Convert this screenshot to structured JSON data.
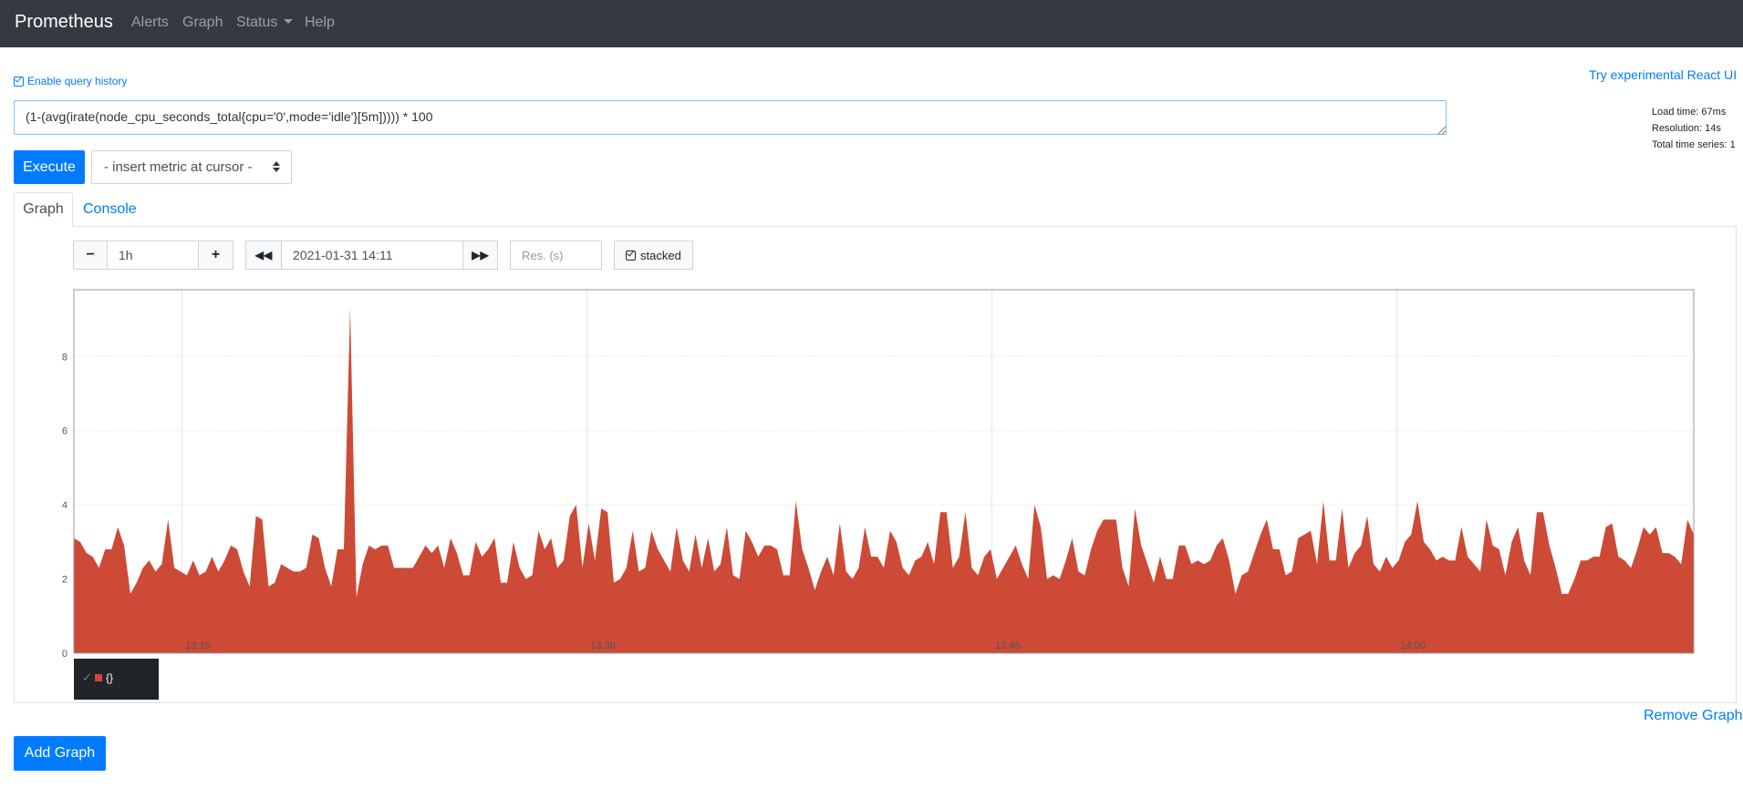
{
  "navbar": {
    "brand": "Prometheus",
    "items": [
      "Alerts",
      "Graph",
      "Status",
      "Help"
    ]
  },
  "history_label": "Enable query history",
  "react_link": "Try experimental React UI",
  "stats": {
    "load_time": "Load time: 67ms",
    "resolution": "Resolution: 14s",
    "total_series": "Total time series: 1"
  },
  "expression": "(1-(avg(irate(node_cpu_seconds_total{cpu='0',mode='idle'}[5m])))) * 100",
  "execute_label": "Execute",
  "metric_select": "- insert metric at cursor -",
  "tabs": {
    "graph": "Graph",
    "console": "Console"
  },
  "controls": {
    "range": "1h",
    "end_time": "2021-01-31 14:11",
    "res_placeholder": "Res. (s)",
    "stacked": "stacked"
  },
  "legend": {
    "label": "{}"
  },
  "remove_label": "Remove Graph",
  "add_label": "Add Graph",
  "colors": {
    "series": "#cc4a36",
    "primary": "#007bff",
    "navbar": "#343a40"
  },
  "icons": [
    "check-square-icon",
    "minus-icon",
    "plus-icon",
    "backward-icon",
    "forward-icon",
    "sort-icon"
  ],
  "chart_data": {
    "type": "area",
    "x_ticks": [
      "13:15",
      "13:30",
      "13:45",
      "14:00"
    ],
    "y_ticks": [
      "0",
      "2",
      "4",
      "6",
      "8"
    ],
    "ylim": [
      0,
      9.8
    ],
    "x_range": [
      "13:11",
      "14:11"
    ],
    "series": [
      {
        "name": "{}",
        "step_seconds": 14,
        "values": [
          3.1,
          3.0,
          2.7,
          2.6,
          2.3,
          2.8,
          2.8,
          3.4,
          2.9,
          1.6,
          1.9,
          2.3,
          2.5,
          2.2,
          2.4,
          3.6,
          2.3,
          2.2,
          2.1,
          2.5,
          2.1,
          2.2,
          2.6,
          2.2,
          2.5,
          2.9,
          2.8,
          2.2,
          1.8,
          3.7,
          3.6,
          1.8,
          1.9,
          2.4,
          2.3,
          2.2,
          2.2,
          2.3,
          3.2,
          3.1,
          2.3,
          1.8,
          2.8,
          2.8,
          9.3,
          1.5,
          2.4,
          2.9,
          2.8,
          2.9,
          2.9,
          2.3,
          2.3,
          2.3,
          2.3,
          2.6,
          2.9,
          2.7,
          2.9,
          2.3,
          3.1,
          2.7,
          2.1,
          2.1,
          3.0,
          2.6,
          2.8,
          3.1,
          1.9,
          1.9,
          3.0,
          2.3,
          2.0,
          2.1,
          3.3,
          2.8,
          3.1,
          2.3,
          2.5,
          3.7,
          4.0,
          2.3,
          3.5,
          2.5,
          3.9,
          3.8,
          1.9,
          2.0,
          2.3,
          3.3,
          2.2,
          2.3,
          3.3,
          2.8,
          2.5,
          2.2,
          3.4,
          2.5,
          2.2,
          3.2,
          2.3,
          3.1,
          2.2,
          2.4,
          3.4,
          2.1,
          2.0,
          3.3,
          3.0,
          2.6,
          2.9,
          2.9,
          2.8,
          2.1,
          2.1,
          4.1,
          2.8,
          2.3,
          1.7,
          2.2,
          2.6,
          2.1,
          3.5,
          2.2,
          2.0,
          2.3,
          3.4,
          2.6,
          2.6,
          2.3,
          3.3,
          3.0,
          2.3,
          2.1,
          2.5,
          2.6,
          3.0,
          2.4,
          3.8,
          3.8,
          2.3,
          2.6,
          3.8,
          2.3,
          2.1,
          2.6,
          2.8,
          2.0,
          2.3,
          2.6,
          2.9,
          2.4,
          2.0,
          4.0,
          3.4,
          2.0,
          2.1,
          2.0,
          2.5,
          3.1,
          2.2,
          2.1,
          2.8,
          3.3,
          3.6,
          3.6,
          3.6,
          2.3,
          1.8,
          3.9,
          2.9,
          2.4,
          1.9,
          2.6,
          2.0,
          2.0,
          2.9,
          2.9,
          2.4,
          2.5,
          2.4,
          2.5,
          2.9,
          3.1,
          2.5,
          1.6,
          2.1,
          2.2,
          2.7,
          3.2,
          3.6,
          2.8,
          2.8,
          2.1,
          2.2,
          3.1,
          3.2,
          3.3,
          2.4,
          4.1,
          2.5,
          2.5,
          3.9,
          2.3,
          2.7,
          2.9,
          3.7,
          2.4,
          2.2,
          2.6,
          2.3,
          2.5,
          3.0,
          3.2,
          4.1,
          3.0,
          2.8,
          2.5,
          2.6,
          2.5,
          2.5,
          3.4,
          2.6,
          2.4,
          2.2,
          3.6,
          2.9,
          2.8,
          2.1,
          3.0,
          3.4,
          2.5,
          2.1,
          3.8,
          3.8,
          2.9,
          2.3,
          1.6,
          1.6,
          2.0,
          2.5,
          2.5,
          2.6,
          2.6,
          3.4,
          3.5,
          2.6,
          2.5,
          2.3,
          2.8,
          3.4,
          3.2,
          3.4,
          2.7,
          2.7,
          2.6,
          2.4,
          3.6,
          3.2
        ]
      }
    ]
  }
}
